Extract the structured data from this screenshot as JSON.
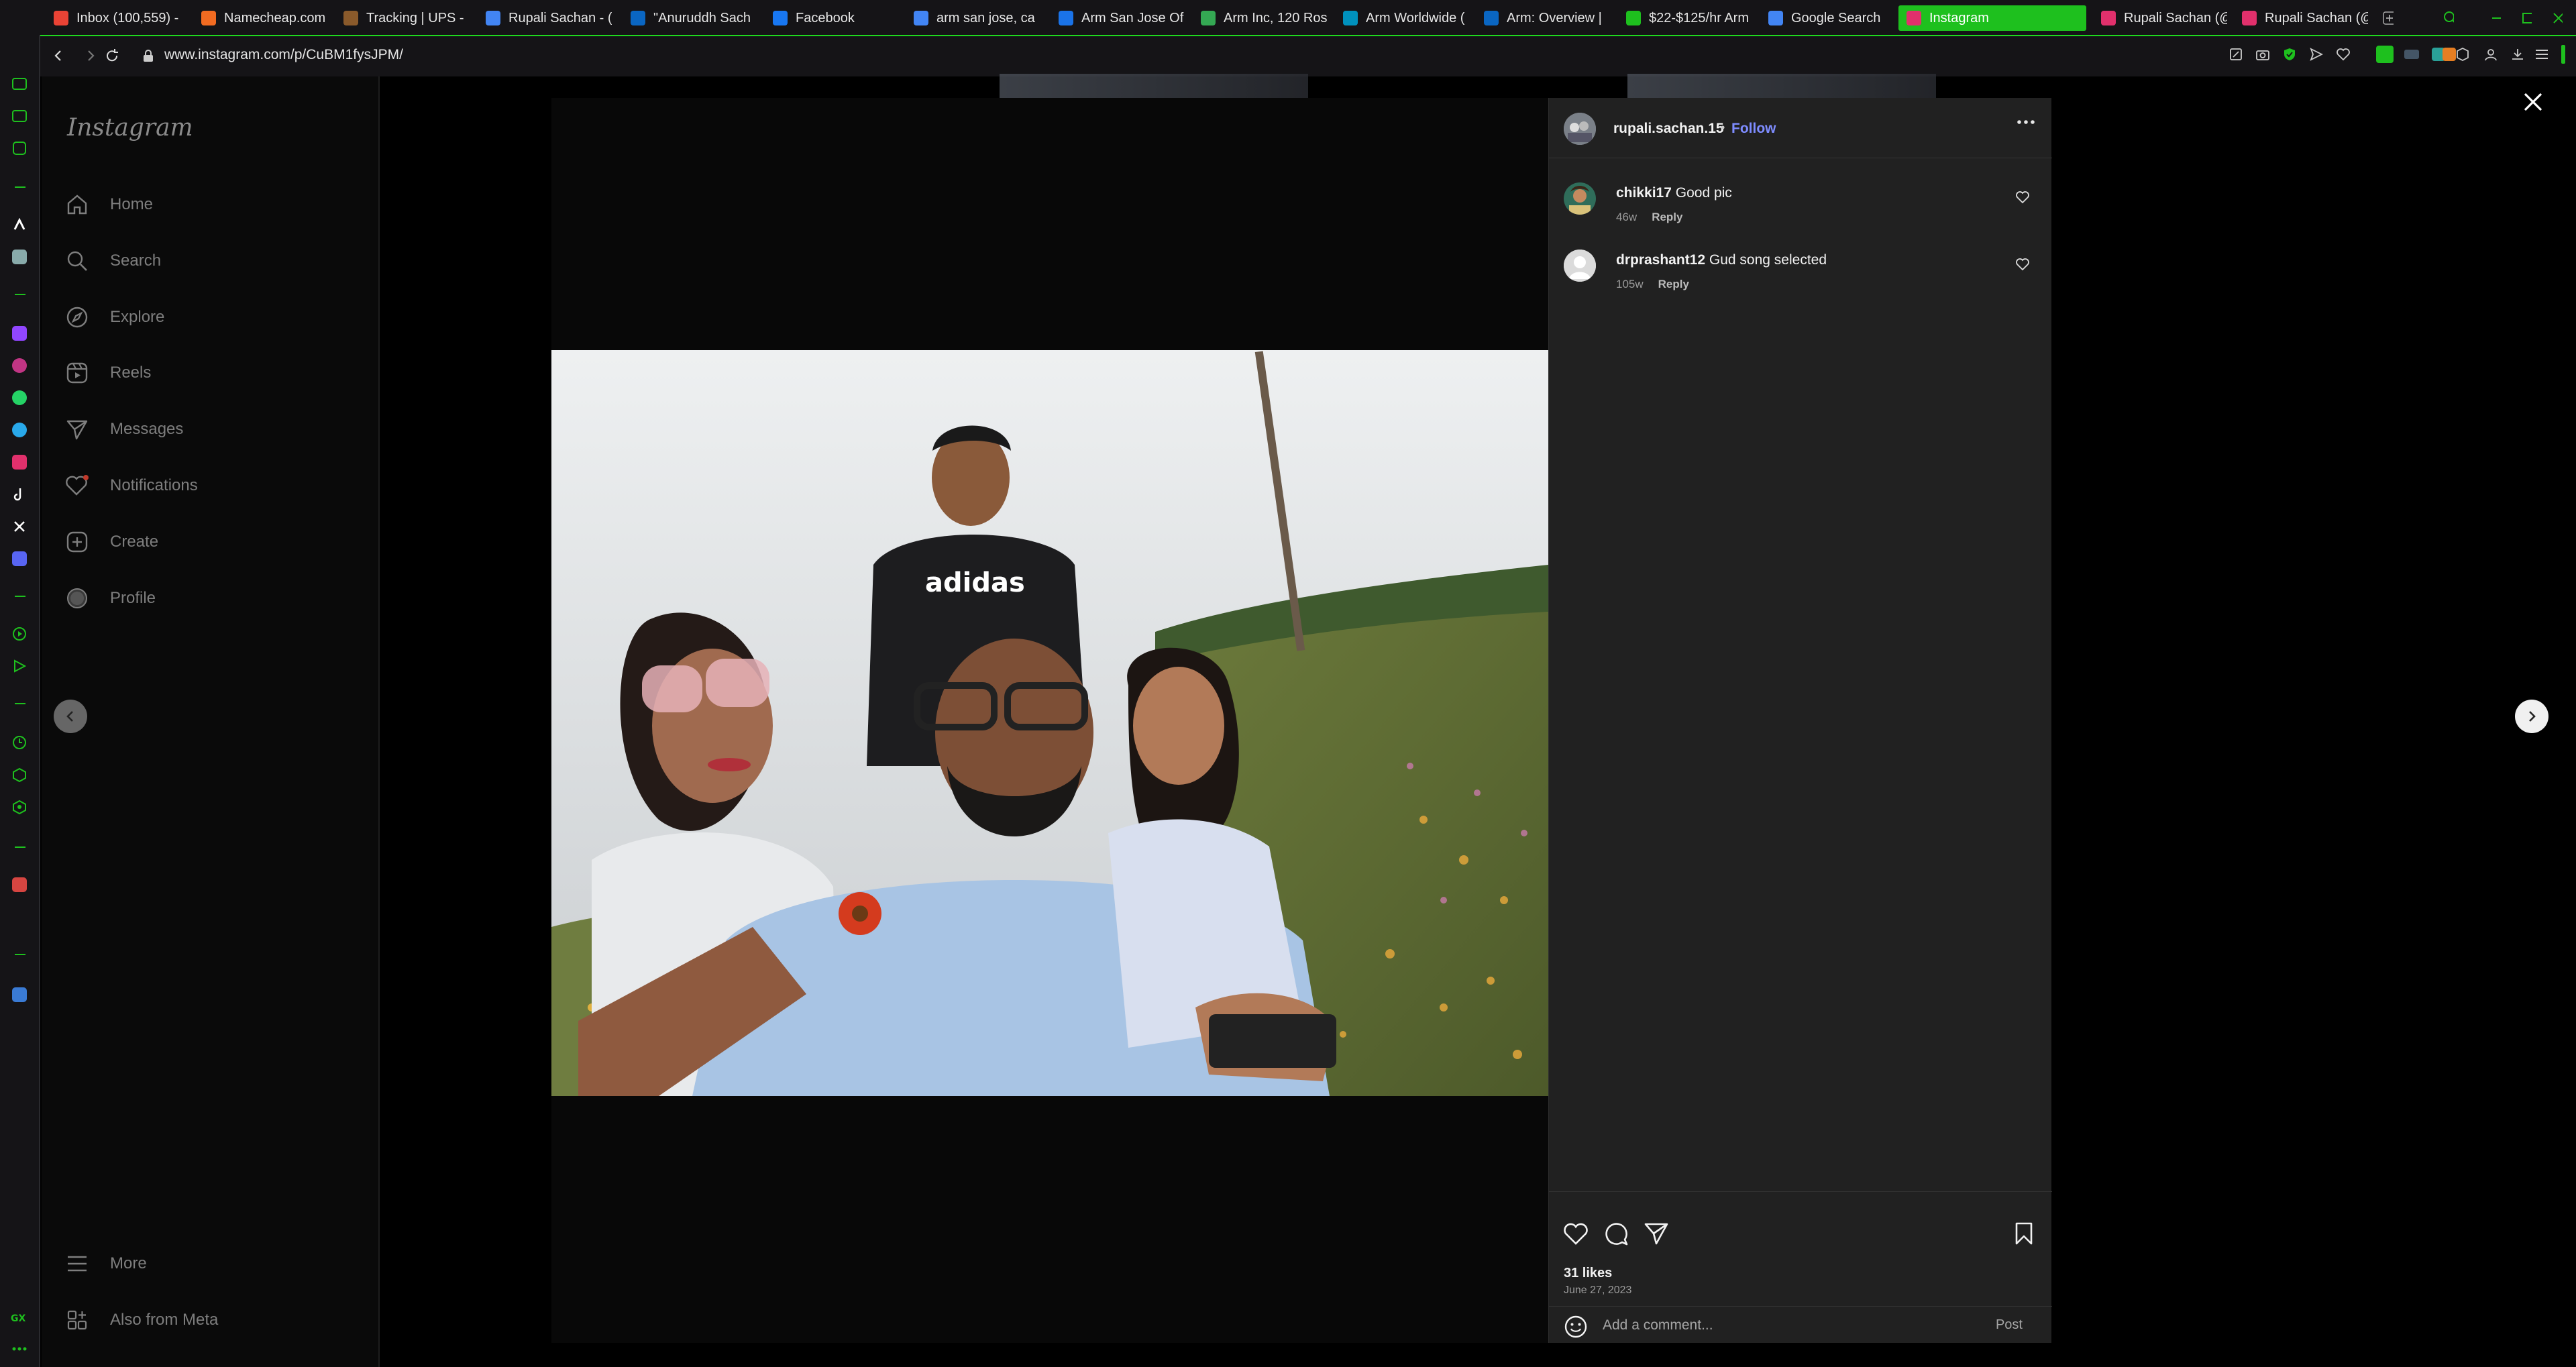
{
  "browser": {
    "tabs": [
      {
        "label": "Inbox (100,559) -",
        "color": "#ea4335"
      },
      {
        "label": "Namecheap.com",
        "color": "#f26b21"
      },
      {
        "label": "Tracking | UPS -",
        "color": "#8a5a2b"
      },
      {
        "label": "Rupali Sachan - (",
        "color": "#4285f4"
      },
      {
        "label": "\"Anuruddh Sach",
        "color": "#0a66c2"
      },
      {
        "label": "Facebook",
        "color": "#1877f2"
      },
      {
        "label": "arm san jose, ca",
        "color": "#4285f4"
      },
      {
        "label": "Arm San Jose Of",
        "color": "#1a73e8"
      },
      {
        "label": "Arm Inc, 120 Ros",
        "color": "#34a853"
      },
      {
        "label": "Arm Worldwide (",
        "color": "#0091bd"
      },
      {
        "label": "Arm: Overview |",
        "color": "#0a66c2"
      },
      {
        "label": "$22-$125/hr Arm",
        "color": "#1ec01e"
      },
      {
        "label": "Google Search",
        "color": "#4285f4"
      },
      {
        "label": "Instagram",
        "color": "#e1306c",
        "active": true
      },
      {
        "label": "Rupali Sachan (@",
        "color": "#e1306c"
      },
      {
        "label": "Rupali Sachan (@",
        "color": "#e1306c"
      }
    ],
    "url": "www.instagram.com/p/CuBM1fysJPM/"
  },
  "ig_nav": {
    "logo": "Instagram",
    "items": [
      {
        "label": "Home",
        "icon": "home-icon"
      },
      {
        "label": "Search",
        "icon": "search-icon"
      },
      {
        "label": "Explore",
        "icon": "compass-icon"
      },
      {
        "label": "Reels",
        "icon": "reels-icon"
      },
      {
        "label": "Messages",
        "icon": "messages-icon"
      },
      {
        "label": "Notifications",
        "icon": "heart-icon"
      },
      {
        "label": "Create",
        "icon": "plus-square-icon"
      },
      {
        "label": "Profile",
        "icon": "profile-icon"
      }
    ],
    "more": "More",
    "also_from_meta": "Also from Meta"
  },
  "post": {
    "author": "rupali.sachan.15",
    "separator": "•",
    "follow_label": "Follow",
    "photo_text": "adidas",
    "comments": [
      {
        "user": "chikki17",
        "text": "Good pic",
        "age": "46w",
        "reply": "Reply"
      },
      {
        "user": "drprashant12",
        "text": "Gud song selected",
        "age": "105w",
        "reply": "Reply"
      }
    ],
    "likes": "31 likes",
    "date": "June 27, 2023",
    "comment_placeholder": "Add a comment...",
    "post_label": "Post"
  },
  "colors": {
    "accent": "#1ec01e",
    "follow": "#7e8cff",
    "panel": "#212121"
  }
}
